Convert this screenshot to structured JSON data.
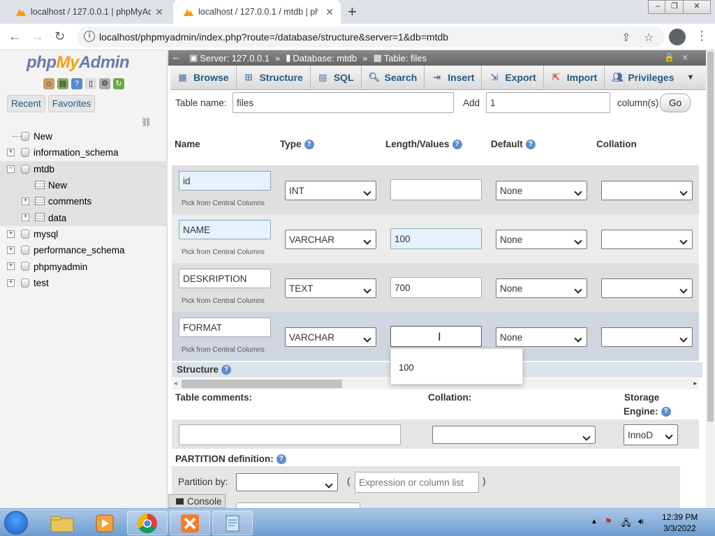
{
  "browser": {
    "tabs": [
      {
        "title": "localhost / 127.0.0.1 | phpMyAdm",
        "active": false
      },
      {
        "title": "localhost / 127.0.0.1 / mtdb | php",
        "active": true
      }
    ],
    "url": "localhost/phpmyadmin/index.php?route=/database/structure&server=1&db=mtdb"
  },
  "nav": {
    "logo": {
      "php": "php",
      "my": "My",
      "admin": "Admin"
    },
    "tabs": [
      "Recent",
      "Favorites"
    ],
    "tree": [
      {
        "label": "New",
        "level": 0,
        "kind": "new"
      },
      {
        "label": "information_schema",
        "level": 0,
        "kind": "db"
      },
      {
        "label": "mtdb",
        "level": 0,
        "kind": "db",
        "expanded": true
      },
      {
        "label": "New",
        "level": 1,
        "kind": "new"
      },
      {
        "label": "comments",
        "level": 1,
        "kind": "table"
      },
      {
        "label": "data",
        "level": 1,
        "kind": "table"
      },
      {
        "label": "mysql",
        "level": 0,
        "kind": "db"
      },
      {
        "label": "performance_schema",
        "level": 0,
        "kind": "db"
      },
      {
        "label": "phpmyadmin",
        "level": 0,
        "kind": "db"
      },
      {
        "label": "test",
        "level": 0,
        "kind": "db"
      }
    ]
  },
  "breadcrumb": {
    "server": "Server: 127.0.0.1",
    "database": "Database: mtdb",
    "table": "Table: files"
  },
  "menu": [
    "Browse",
    "Structure",
    "SQL",
    "Search",
    "Insert",
    "Export",
    "Import",
    "Privileges"
  ],
  "form": {
    "table_name_label": "Table name:",
    "table_name": "files",
    "add_label": "Add",
    "add_count": "1",
    "columns_label": "column(s)",
    "go_label": "Go",
    "headers": {
      "name": "Name",
      "type": "Type",
      "length": "Length/Values",
      "default": "Default",
      "collation": "Collation"
    },
    "pick_text": "Pick from Central Columns",
    "rows": [
      {
        "name": "id",
        "type": "INT",
        "length": "",
        "default": "None",
        "collation": ""
      },
      {
        "name": "NAME",
        "type": "VARCHAR",
        "length": "100",
        "default": "None",
        "collation": ""
      },
      {
        "name": "DESKRIPTION",
        "type": "TEXT",
        "length": "700",
        "default": "None",
        "collation": ""
      },
      {
        "name": "FORMAT",
        "type": "VARCHAR",
        "length": "",
        "default": "None",
        "collation": ""
      }
    ],
    "autocomplete_suggestion": "100",
    "structure_label": "Structure",
    "table_comments_label": "Table comments:",
    "collation_label": "Collation:",
    "storage_label_1": "Storage",
    "storage_label_2": "Engine:",
    "storage_value": "InnoD",
    "partition_label": "PARTITION definition:",
    "partition_by_label": "Partition by:",
    "partition_expr_placeholder": "Expression or column list",
    "console_label": "Console"
  },
  "taskbar": {
    "time": "12:39 PM",
    "date": "3/3/2022"
  }
}
